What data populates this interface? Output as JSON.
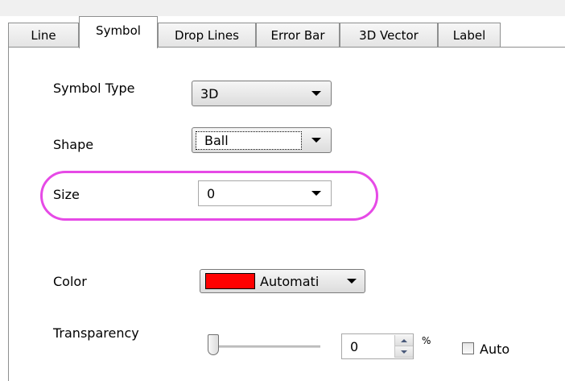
{
  "tabs": [
    {
      "label": "Line"
    },
    {
      "label": "Symbol",
      "active": true
    },
    {
      "label": "Drop Lines"
    },
    {
      "label": "Error Bar"
    },
    {
      "label": "3D Vector"
    },
    {
      "label": "Label"
    }
  ],
  "symbol_type": {
    "label": "Symbol Type",
    "value": "3D"
  },
  "shape": {
    "label": "Shape",
    "value": "Ball"
  },
  "size": {
    "label": "Size",
    "value": "0"
  },
  "color": {
    "label": "Color",
    "value": "Automati",
    "swatch": "#ff0000"
  },
  "transparency": {
    "label": "Transparency",
    "value": "0",
    "unit": "%",
    "slider_fraction": 0.0
  },
  "auto": {
    "label": "Auto",
    "checked": false
  },
  "highlight_color": "#e64ae6"
}
